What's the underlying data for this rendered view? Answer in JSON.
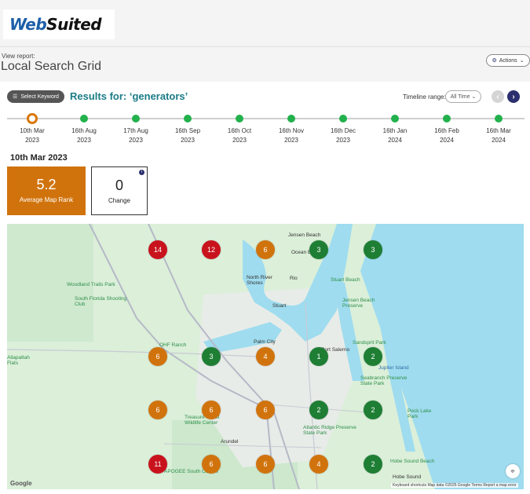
{
  "brand": {
    "logo_part1": "Web",
    "logo_part2": "Suited"
  },
  "page": {
    "view_label": "View report:",
    "title": "Local Search Grid",
    "actions_label": "Actions"
  },
  "toolbar": {
    "select_keyword_label": "Select Keyword",
    "results_label": "Results for: ‘generators’",
    "timeline_range_label": "Timeline range:",
    "timeline_range_value": "All Time"
  },
  "timeline": [
    {
      "day": "10th Mar",
      "year": "2023",
      "active": true
    },
    {
      "day": "16th Aug",
      "year": "2023"
    },
    {
      "day": "17th Aug",
      "year": "2023"
    },
    {
      "day": "16th Sep",
      "year": "2023"
    },
    {
      "day": "16th Oct",
      "year": "2023"
    },
    {
      "day": "16th Nov",
      "year": "2023"
    },
    {
      "day": "16th Dec",
      "year": "2023"
    },
    {
      "day": "16th Jan",
      "year": "2024"
    },
    {
      "day": "16th Feb",
      "year": "2024"
    },
    {
      "day": "16th Mar",
      "year": "2024"
    }
  ],
  "summary": {
    "date": "10th Mar 2023",
    "average_rank": "5.2",
    "average_rank_label": "Average Map Rank",
    "change": "0",
    "change_label": "Change"
  },
  "colors": {
    "red": "#c8131d",
    "orange": "#d1730d",
    "green": "#1e7e34",
    "accent": "#1a7c86",
    "nav": "#2b2f6e"
  },
  "grid": {
    "rows": [
      [
        "14",
        "12",
        "6",
        "3",
        "3"
      ],
      [
        "6",
        "3",
        "4",
        "1",
        "2"
      ],
      [
        "6",
        "6",
        "6",
        "2",
        "2"
      ],
      [
        "11",
        "6",
        "6",
        "4",
        "2"
      ]
    ]
  },
  "map_labels": {
    "jensen_beach": "Jensen Beach",
    "ocean_breeze": "Ocean Breeze",
    "north_river_shores": "North River Shores",
    "rio": "Rio",
    "stuart": "Stuart",
    "palm_city": "Palm City",
    "port_salerno": "Port Salerno",
    "jupiter_island": "Jupiter Island",
    "hobe_sound": "Hobe Sound",
    "arundel": "Arundel",
    "alapattah_flats": "Allapattah Flats",
    "woodland_trails": "Woodland Trails Park",
    "shooting_club": "South Florida Shooting Club",
    "ohf_ranch": "OHF Ranch",
    "treasure_wildlife": "Treasure Coast Wildlife Center",
    "atlantic_ridge": "Atlantic Ridge Preserve State Park",
    "sandsprint": "Sandsprit Park",
    "stuart_beach": "Stuart Beach",
    "jensen_preserve": "Jensen Beach Preserve",
    "seabranch": "Seabranch Preserve State Park",
    "peck_lake": "Peck Lake Park",
    "hobe_sound_beach": "Hobe Sound Beach",
    "apogee": "APOGEE South Course",
    "google": "Google",
    "attribution": "Keyboard shortcuts   Map data ©2025 Google   Terms   Report a map error"
  }
}
